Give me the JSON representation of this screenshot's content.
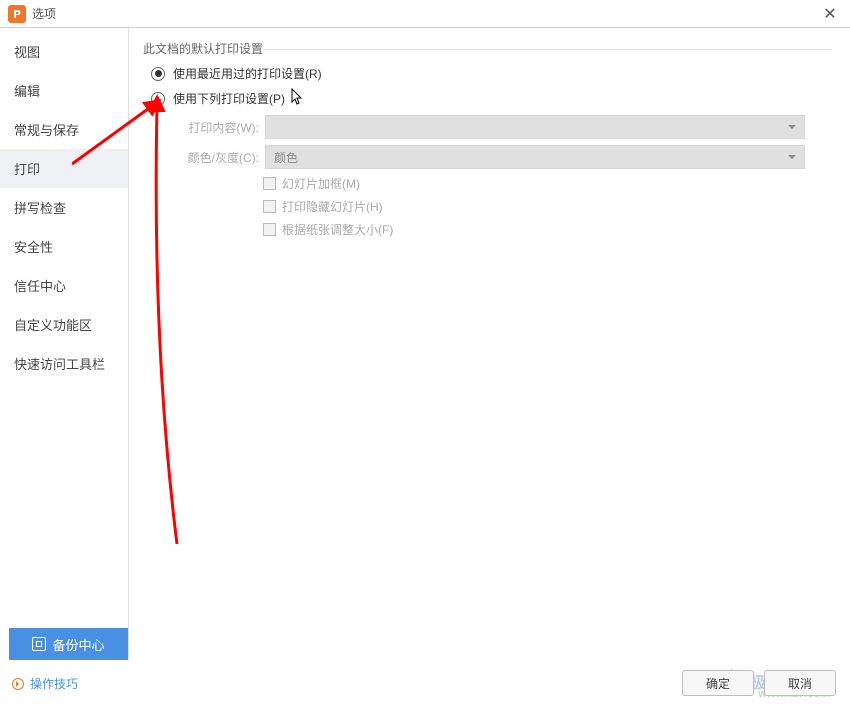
{
  "window": {
    "title": "选项"
  },
  "sidebar": {
    "items": [
      {
        "label": "视图"
      },
      {
        "label": "编辑"
      },
      {
        "label": "常规与保存"
      },
      {
        "label": "打印"
      },
      {
        "label": "拼写检查"
      },
      {
        "label": "安全性"
      },
      {
        "label": "信任中心"
      },
      {
        "label": "自定义功能区"
      },
      {
        "label": "快速访问工具栏"
      }
    ],
    "active_index": 3
  },
  "main": {
    "group_title": "此文档的默认打印设置",
    "radio": {
      "recent": "使用最近用过的打印设置(R)",
      "below": "使用下列打印设置(P)"
    },
    "labels": {
      "content": "打印内容(W):",
      "color": "颜色/灰度(C):"
    },
    "dropdowns": {
      "content_value": "",
      "color_value": "颜色"
    },
    "checkboxes": {
      "frame": "幻灯片加框(M)",
      "hidden": "打印隐藏幻灯片(H)",
      "fit": "根据纸张调整大小(F)"
    }
  },
  "footer": {
    "backup": "备份中心",
    "tips": "操作技巧",
    "ok": "确定",
    "cancel": "取消"
  },
  "watermark": {
    "text": "极光下载站",
    "url": "www.xz7.com"
  }
}
